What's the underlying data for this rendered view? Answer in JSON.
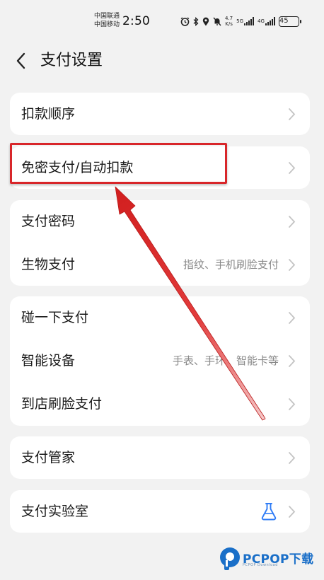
{
  "status_bar": {
    "carrier_1": "中国联通",
    "carrier_2": "中国移动",
    "time": "2:50",
    "speed_value": "4.7",
    "speed_unit": "K/s",
    "network_1": "5G",
    "network_2": "4G",
    "battery": "45"
  },
  "header": {
    "title": "支付设置"
  },
  "groups": [
    {
      "rows": [
        {
          "label": "扣款顺序",
          "value": ""
        }
      ]
    },
    {
      "rows": [
        {
          "label": "免密支付/自动扣款",
          "value": ""
        }
      ]
    },
    {
      "rows": [
        {
          "label": "支付密码",
          "value": ""
        },
        {
          "label": "生物支付",
          "value": "指纹、手机刷脸支付"
        }
      ]
    },
    {
      "rows": [
        {
          "label": "碰一下支付",
          "value": ""
        },
        {
          "label": "智能设备",
          "value": "手表、手环、智能卡等"
        },
        {
          "label": "到店刷脸支付",
          "value": ""
        }
      ]
    },
    {
      "rows": [
        {
          "label": "支付管家",
          "value": ""
        }
      ]
    },
    {
      "rows": [
        {
          "label": "支付实验室",
          "value": "",
          "icon": "flask-icon"
        }
      ]
    }
  ],
  "watermark": {
    "text": "PCPOP下载",
    "subtext": "PCPOP Download"
  },
  "colors": {
    "highlight": "#d8262a",
    "flask": "#2f7cf6",
    "watermark": "#1a6fc8"
  }
}
